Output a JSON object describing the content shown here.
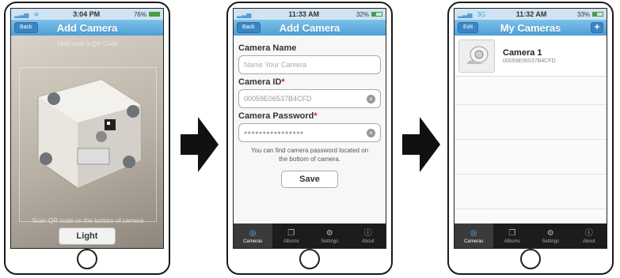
{
  "phone1": {
    "status": {
      "time": "3:04 PM",
      "battery": "76%"
    },
    "nav": {
      "back": "Back",
      "title": "Add Camera"
    },
    "camera": {
      "hint_top": "Hold over a QR Code",
      "hint_bottom": "Scan QR code on the bottom of camera"
    },
    "light_button": "Light"
  },
  "phone2": {
    "status": {
      "time": "11:33 AM",
      "battery": "32%"
    },
    "nav": {
      "back": "Back",
      "title": "Add Camera"
    },
    "form": {
      "name_label": "Camera Name",
      "name_placeholder": "Name Your Camera",
      "id_label": "Camera ID",
      "id_value": "00059E06537B4CFD",
      "password_label": "Camera Password",
      "password_value": "●●●●●●●●●●●●●●●●",
      "required_mark": "*",
      "help_text_1": "You can find camera password located on",
      "help_text_2": "the bottom of camera.",
      "save_label": "Save"
    },
    "tabs": [
      {
        "label": "Cameras",
        "icon": "camera-icon"
      },
      {
        "label": "Albums",
        "icon": "albums-icon"
      },
      {
        "label": "Settings",
        "icon": "settings-icon"
      },
      {
        "label": "About",
        "icon": "info-icon"
      }
    ]
  },
  "phone3": {
    "status": {
      "carrier": "3G",
      "time": "11:32 AM",
      "battery": "33%"
    },
    "nav": {
      "edit": "Edit",
      "title": "My Cameras",
      "add": "+"
    },
    "cameras": [
      {
        "name": "Camera 1",
        "id": "00059E06537B4CFD"
      }
    ],
    "tabs": [
      {
        "label": "Cameras",
        "icon": "camera-icon"
      },
      {
        "label": "Albums",
        "icon": "albums-icon"
      },
      {
        "label": "Settings",
        "icon": "settings-icon"
      },
      {
        "label": "About",
        "icon": "info-icon"
      }
    ]
  },
  "colors": {
    "nav_blue": "#4e9fd6",
    "tabbar": "#1c1c1c",
    "required": "#dd2222"
  }
}
